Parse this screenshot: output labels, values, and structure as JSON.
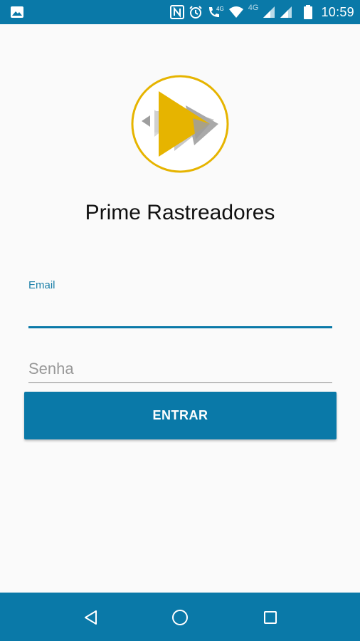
{
  "status_bar": {
    "time": "10:59",
    "network_type": "4G",
    "icons": [
      "image-notification-icon",
      "nfc-icon",
      "alarm-icon",
      "volte-call-icon",
      "wifi-icon",
      "signal-icon",
      "signal-icon",
      "battery-icon"
    ]
  },
  "app": {
    "title": "Prime Rastreadores",
    "logo": {
      "ring_color": "#e6b400",
      "play_color": "#e6b400",
      "arrow_color": "#9e9e9e"
    }
  },
  "login_form": {
    "email_label": "Email",
    "email_value": "",
    "password_placeholder": "Senha",
    "submit_label": "ENTRAR"
  },
  "nav_bar": {
    "buttons": [
      "back-icon",
      "home-icon",
      "recents-icon"
    ]
  },
  "colors": {
    "primary": "#0a79a8",
    "background": "#fafafa"
  }
}
